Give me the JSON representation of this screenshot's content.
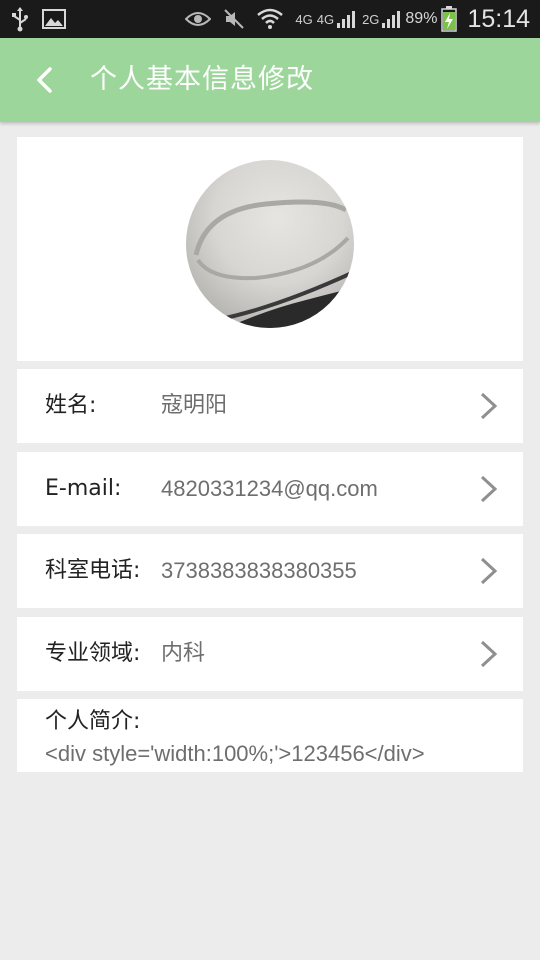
{
  "status_bar": {
    "network_4g_a": "4G",
    "network_4g_b": "4G",
    "network_2g": "2G",
    "battery_percent": "89%",
    "time": "15:14"
  },
  "header": {
    "title": "个人基本信息修改",
    "color": "#9cd69a"
  },
  "profile": {
    "name_label": "姓名:",
    "name_value": "寇明阳",
    "email_label": "E-mail:",
    "email_value": "4820331234@qq.com",
    "phone_label": "科室电话:",
    "phone_value": "3738383838380355",
    "field_label": "专业领域:",
    "field_value": "内科",
    "intro_label": "个人简介:",
    "intro_value": "<div style='width:100%;'>123456</div>"
  }
}
